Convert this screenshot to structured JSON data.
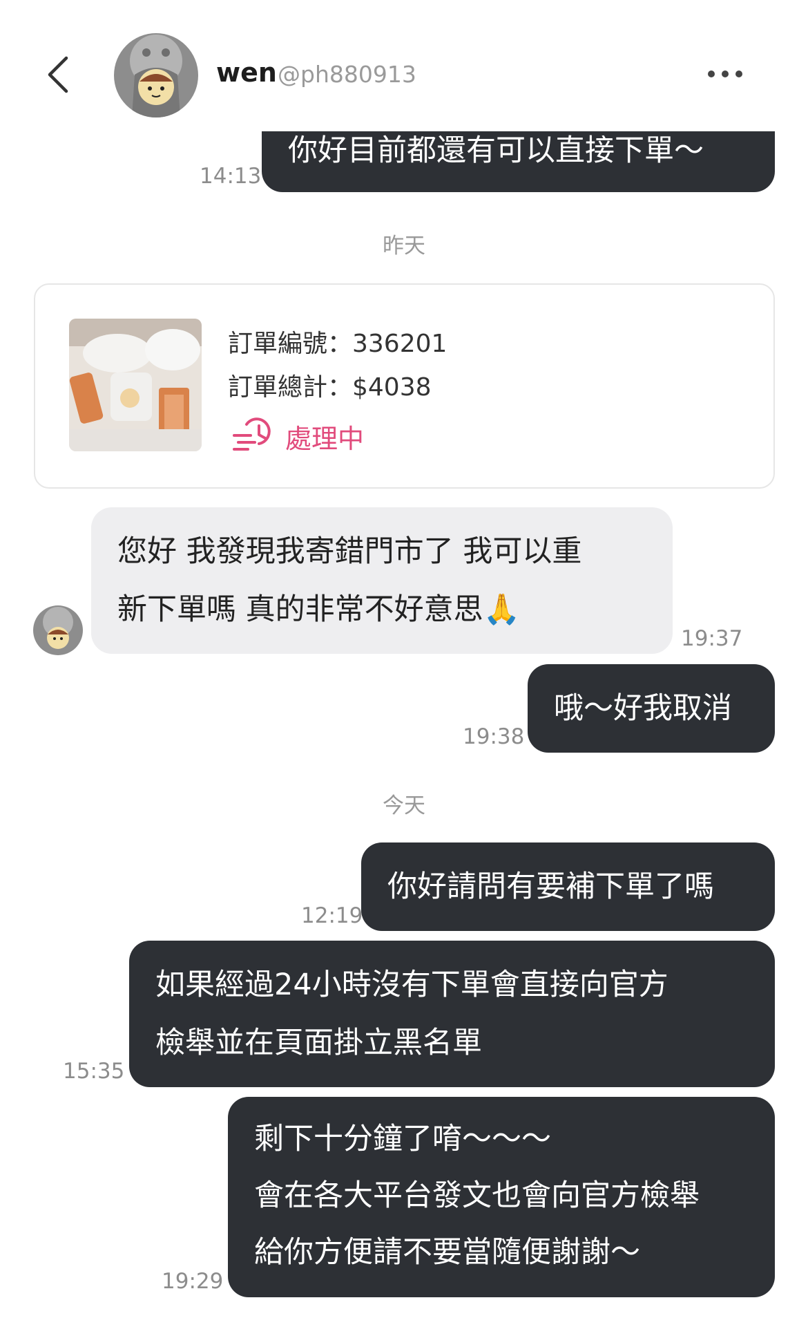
{
  "header": {
    "username": "wen",
    "handle": "@ph880913"
  },
  "messages": [
    {
      "text": "你好目前都還有可以直接下單～",
      "time": "14:13"
    },
    {
      "text": "您好 我發現我寄錯門市了 我可以重",
      "text2": "新下單嗎 真的非常不好意思🙏",
      "time": "19:37"
    },
    {
      "text": "哦～好我取消",
      "time": "19:38"
    },
    {
      "text": "你好請問有要補下單了嗎",
      "time": "12:19"
    },
    {
      "text": "如果經過24小時沒有下單會直接向官方",
      "text2": "檢舉並在頁面掛立黑名單",
      "time": "15:35"
    },
    {
      "text": "剩下十分鐘了唷～～～",
      "text2": "會在各大平台發文也會向官方檢舉",
      "text3": "給你方便請不要當隨便謝謝～",
      "time": "19:29"
    }
  ],
  "days": {
    "yesterday": "昨天",
    "today": "今天"
  },
  "order": {
    "number_label": "訂單編號：336201",
    "total_label": "訂單總計：$4038",
    "status": "處理中",
    "status_color": "#e14b7c"
  },
  "colors": {
    "my_bubble": "#2d3035",
    "their_bubble": "#eeeef0"
  }
}
